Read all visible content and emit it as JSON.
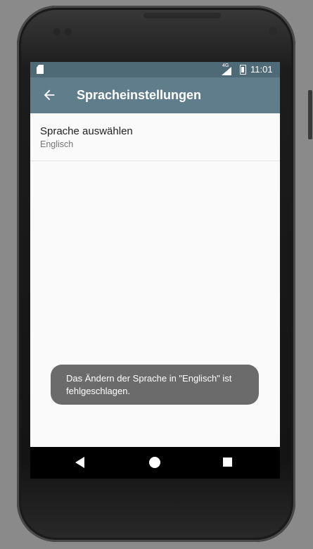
{
  "status_bar": {
    "network_label": "4G",
    "time": "11:01"
  },
  "toolbar": {
    "title": "Spracheinstellungen"
  },
  "preferences": [
    {
      "title": "Sprache auswählen",
      "summary": "Englisch"
    }
  ],
  "toast": {
    "message": "Das Ändern der Sprache in \"Englisch\" ist fehlgeschlagen."
  },
  "colors": {
    "status_bar": "#4f6a77",
    "toolbar": "#607d8b",
    "toast": "#6b6b6b",
    "screen_bg": "#fafafa"
  },
  "icons": {
    "status_left": "sd-card-icon",
    "signal": "signal-icon",
    "battery": "battery-charging-icon",
    "toolbar_nav": "arrow-back-icon",
    "nav_back": "nav-back-icon",
    "nav_home": "nav-home-icon",
    "nav_recents": "nav-recents-icon"
  }
}
